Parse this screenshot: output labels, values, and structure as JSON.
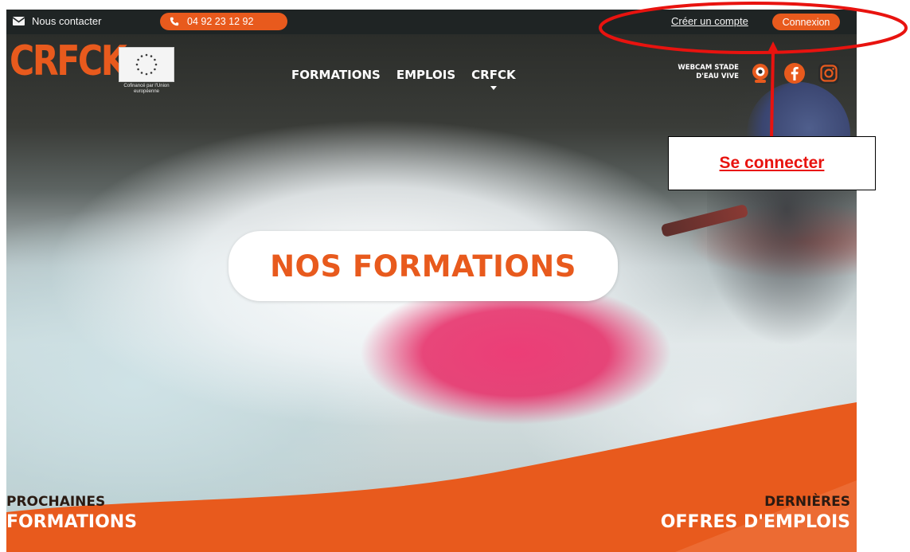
{
  "topbar": {
    "contact_label": "Nous contacter",
    "phone": "04 92 23 12 92",
    "create_account": "Créer un compte",
    "login": "Connexion"
  },
  "header": {
    "logo_text": "CRFCK",
    "eu_caption": "Cofinancé par l'Union européenne",
    "nav": [
      {
        "label": "FORMATIONS"
      },
      {
        "label": "EMPLOIS"
      },
      {
        "label": "CRFCK"
      }
    ],
    "webcam_label_1": "WEBCAM STADE",
    "webcam_label_2": "D'EAU VIVE",
    "social_icons": [
      "webcam-icon",
      "facebook-icon",
      "instagram-icon"
    ]
  },
  "hero": {
    "cta_label": "NOS FORMATIONS"
  },
  "sections": {
    "next_trainings_line1": "PROCHAINES",
    "next_trainings_line2": "FORMATIONS",
    "latest_jobs_line1": "DERNIÈRES",
    "latest_jobs_line2": "OFFRES D'EMPLOIS"
  },
  "annotation": {
    "callout_text": "Se connecter"
  },
  "colors": {
    "brand_orange": "#e85a1d",
    "topbar_bg": "#1f2424",
    "annotation_red": "#e8130f"
  }
}
